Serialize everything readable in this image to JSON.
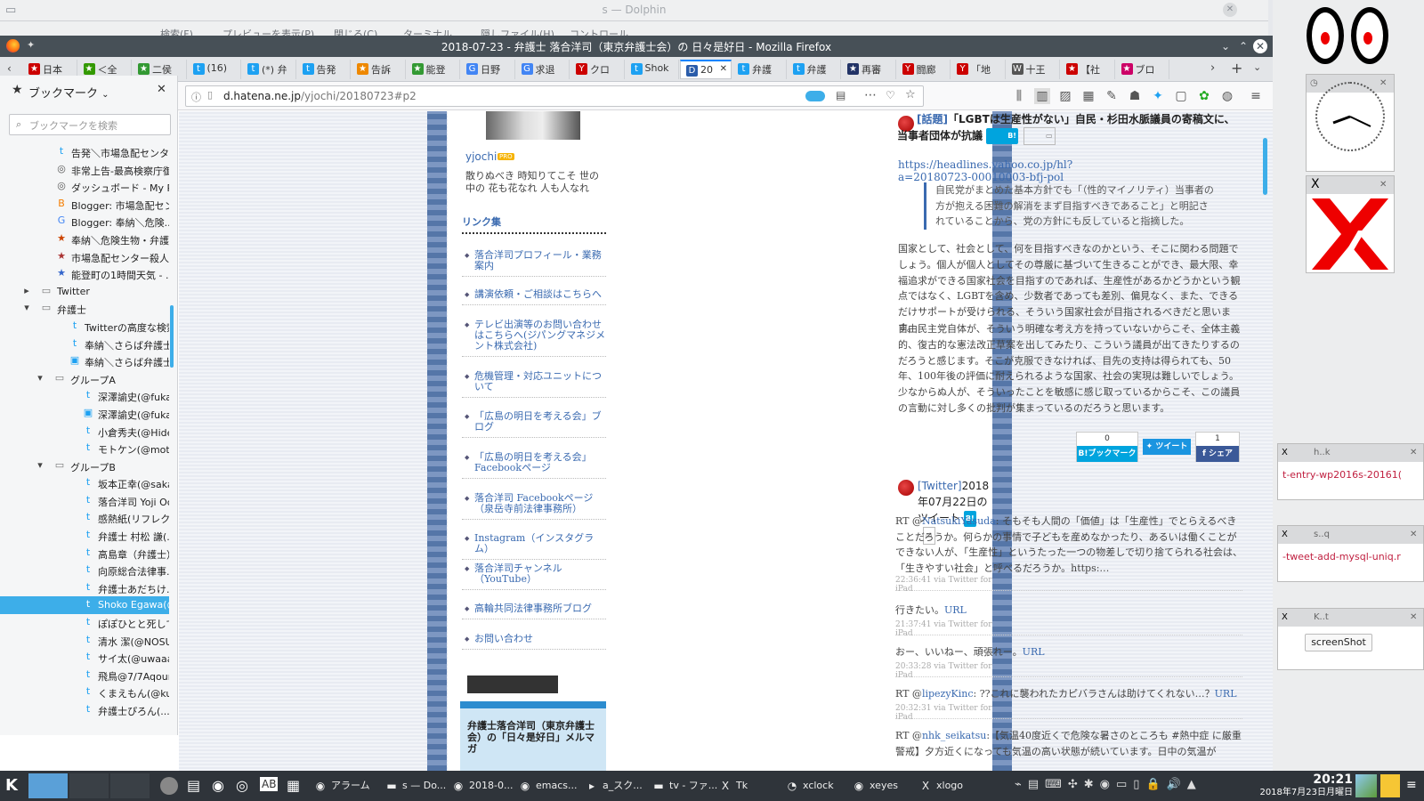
{
  "dolphin": {
    "title": "s — Dolphin",
    "toolbar": [
      "検索(F)",
      "プレビューを表示(P)",
      "閉じる(C)",
      "ターミナル",
      "隠しファイル(H)",
      "コントロール"
    ]
  },
  "firefox": {
    "title": "2018-07-23 - 弁護士 落合洋司（東京弁護士会）の 日々是好日 - Mozilla Firefox",
    "tabs": [
      {
        "label": "日本",
        "fav": "★",
        "color": "#c00"
      },
      {
        "label": "＜全",
        "fav": "★",
        "color": "#390"
      },
      {
        "label": "二侯",
        "fav": "★",
        "color": "#393"
      },
      {
        "label": "(16)",
        "fav": "t",
        "color": "#1da1f2"
      },
      {
        "label": "(*) 弁",
        "fav": "t",
        "color": "#1da1f2"
      },
      {
        "label": "告発",
        "fav": "t",
        "color": "#1da1f2"
      },
      {
        "label": "告訴",
        "fav": "★",
        "color": "#e80"
      },
      {
        "label": "能登",
        "fav": "★",
        "color": "#393"
      },
      {
        "label": "日野",
        "fav": "G",
        "color": "#4285f4"
      },
      {
        "label": "求退",
        "fav": "G",
        "color": "#4285f4"
      },
      {
        "label": "クロ",
        "fav": "Y",
        "color": "#c00"
      },
      {
        "label": "Shok",
        "fav": "t",
        "color": "#1da1f2"
      },
      {
        "label": "20",
        "fav": "D",
        "color": "#2a5caa",
        "active": true
      },
      {
        "label": "弁護",
        "fav": "t",
        "color": "#1da1f2"
      },
      {
        "label": "弁護",
        "fav": "t",
        "color": "#1da1f2"
      },
      {
        "label": "再審",
        "fav": "★",
        "color": "#236"
      },
      {
        "label": "闘廊",
        "fav": "Y",
        "color": "#c00"
      },
      {
        "label": "「地",
        "fav": "Y",
        "color": "#c00"
      },
      {
        "label": "十王",
        "fav": "W",
        "color": "#555"
      },
      {
        "label": "【社",
        "fav": "★",
        "color": "#c00"
      },
      {
        "label": "ブロ",
        "fav": "★",
        "color": "#c06"
      }
    ],
    "url_prefix": "d.hatena.ne.jp",
    "url_rest": "/yjochi/20180723#p2"
  },
  "sidebar": {
    "title": "ブックマーク",
    "search_placeholder": "ブックマークを検索",
    "items": [
      {
        "label": "告発＼市場急配センタ...",
        "indent": 1,
        "icon": "t",
        "color": "#1da1f2"
      },
      {
        "label": "非常上告-最高検察庁御...",
        "indent": 1,
        "icon": "◎",
        "color": "#555"
      },
      {
        "label": "ダッシュボード - My Pro...",
        "indent": 1,
        "icon": "◎",
        "color": "#555"
      },
      {
        "label": "Blogger: 市場急配セン...",
        "indent": 1,
        "icon": "B",
        "color": "#f57d00"
      },
      {
        "label": "Blogger: 奉納＼危険...",
        "indent": 1,
        "icon": "G",
        "color": "#4285f4"
      },
      {
        "label": "奉納＼危険生物・弁護...",
        "indent": 1,
        "icon": "★",
        "color": "#c40"
      },
      {
        "label": "市場急配センター殺人...",
        "indent": 1,
        "icon": "★",
        "color": "#a33"
      },
      {
        "label": "能登町の1時間天気 - ...",
        "indent": 1,
        "icon": "★",
        "color": "#36c"
      },
      {
        "label": "Twitter",
        "indent": 0,
        "icon": "▭",
        "color": "#777",
        "folder": "▸"
      },
      {
        "label": "弁護士",
        "indent": 0,
        "icon": "▭",
        "color": "#777",
        "folder": "▾"
      },
      {
        "label": "Twitterの高度な検索",
        "indent": 2,
        "icon": "t",
        "color": "#1da1f2"
      },
      {
        "label": "奉納＼さらば弁護士...",
        "indent": 2,
        "icon": "t",
        "color": "#1da1f2"
      },
      {
        "label": "奉納＼さらば弁護士...",
        "indent": 2,
        "icon": "▣",
        "color": "#1da1f2"
      },
      {
        "label": "グループA",
        "indent": 1,
        "icon": "▭",
        "color": "#777",
        "folder": "▾"
      },
      {
        "label": "深澤諭史(@fuka...",
        "indent": 3,
        "icon": "t",
        "color": "#1da1f2"
      },
      {
        "label": "深澤諭史(@fuka...",
        "indent": 3,
        "icon": "▣",
        "color": "#1da1f2"
      },
      {
        "label": "小倉秀夫(@Hide...",
        "indent": 3,
        "icon": "t",
        "color": "#1da1f2"
      },
      {
        "label": "モトケン(@moto...",
        "indent": 3,
        "icon": "t",
        "color": "#1da1f2"
      },
      {
        "label": "グループB",
        "indent": 1,
        "icon": "▭",
        "color": "#777",
        "folder": "▾"
      },
      {
        "label": "坂本正幸(@saka...",
        "indent": 3,
        "icon": "t",
        "color": "#1da1f2"
      },
      {
        "label": "落合洋司 Yoji Oc...",
        "indent": 3,
        "icon": "t",
        "color": "#1da1f2"
      },
      {
        "label": "感熱紙(リフレクタ...",
        "indent": 3,
        "icon": "t",
        "color": "#1da1f2"
      },
      {
        "label": "弁護士 村松 謙(...",
        "indent": 3,
        "icon": "t",
        "color": "#1da1f2"
      },
      {
        "label": "高島章（弁護士）(...",
        "indent": 3,
        "icon": "t",
        "color": "#1da1f2"
      },
      {
        "label": "向原総合法律事...",
        "indent": 3,
        "icon": "t",
        "color": "#1da1f2"
      },
      {
        "label": "弁護士あだちけ...",
        "indent": 3,
        "icon": "t",
        "color": "#1da1f2"
      },
      {
        "label": "Shoko Egawa(@...",
        "indent": 3,
        "icon": "t",
        "color": "#1da1f2",
        "selected": true
      },
      {
        "label": "ぽぽひとと死して...",
        "indent": 3,
        "icon": "t",
        "color": "#1da1f2"
      },
      {
        "label": "清水 潔(@NOSU...",
        "indent": 3,
        "icon": "t",
        "color": "#1da1f2"
      },
      {
        "label": "サイ太(@uwaaaa...",
        "indent": 3,
        "icon": "t",
        "color": "#1da1f2"
      },
      {
        "label": "飛鳥@7/7Aqour...",
        "indent": 3,
        "icon": "t",
        "color": "#1da1f2"
      },
      {
        "label": "くまえもん(@kum...",
        "indent": 3,
        "icon": "t",
        "color": "#1da1f2"
      },
      {
        "label": "弁護士ぴろん(...",
        "indent": 3,
        "icon": "t",
        "color": "#1da1f2"
      }
    ]
  },
  "blog": {
    "author": "yjochi",
    "author_tag": "PRO",
    "motto": "散りぬべき 時知りてこそ 世の中の 花も花なれ 人も人なれ",
    "links_title": "リンク集",
    "links": [
      "落合洋司プロフィール・業務案内",
      "講演依頼・ご相談はこちらへ",
      "テレビ出演等のお問い合わせはこちらへ(ジパングマネジメント株式会社)",
      "危機管理・対応ユニットについて",
      "「広島の明日を考える会」ブログ",
      "「広島の明日を考える会」Facebookページ",
      "落合洋司 Facebookページ（泉岳寺前法律事務所）",
      "Instagram（インスタグラム）",
      "落合洋司チャンネル（YouTube）",
      "高輪共同法律事務所ブログ",
      "お問い合わせ"
    ],
    "magazine": "弁護士落合洋司（東京弁護士会）の「日々是好日」メルマガ",
    "post1": {
      "category": "[話題]",
      "title": "「LGBTは生産性がない」自民・杉田水脈議員の寄稿文に、当事者団体が抗議",
      "url": "https://headlines.yahoo.co.jp/hl?a=20180723-00010003-bfj-pol",
      "quote": "自民党がまとめた基本方針でも「（性的マイノリティ）当事者の方が抱える困難の解消をまず目指すべきであること」と明記されていることから、党の方針にも反していると指摘した。",
      "para1": "国家として、社会として、何を目指すべきなのかという、そこに関わる問題でしょう。個人が個人としてその尊厳に基づいて生きることができ、最大限、幸福追求ができる国家社会を目指すのであれば、生産性があるかどうかという観点ではなく、LGBTを含め、少数者であっても差別、偏見なく、また、できるだけサポートが受けられる、そういう国家社会が目指されるべきだと思います。",
      "para2": "自由民主党自体が、そういう明確な考え方を持っていないからこそ、全体主義的、復古的な憲法改正草案を出してみたり、こういう議員が出てきたりするのだろうと感じます。そこが克服できなければ、目先の支持は得られても、50年、100年後の評価に耐えられるような国家、社会の実現は難しいでしょう。少なからぬ人が、そういったことを敏感に感じ取っているからこそ、この議員の言動に対し多くの批判が集まっているのだろうと思います。",
      "share": {
        "hatena_count": "0",
        "hatena_label": "B!ブックマーク",
        "tweet_label": "ツイート",
        "fb_count": "1",
        "fb_label": "シェア"
      }
    },
    "post2": {
      "category": "[Twitter]",
      "title": "2018年07月22日のツイート",
      "tweets": [
        {
          "pre": "RT @",
          "user": "NatsukiYasuda",
          "text": ": そもそも人間の「価値」は「生産性」でとらえるべきことだろうか。何らかの事情で子どもを産めなかったり、あるいは働くことができない人が、「生産性」というたった一つの物差しで切り捨てられる社会は、「生きやすい社会」と呼べるだろうか。https:…",
          "meta": "22:36:41 via Twitter for iPad"
        },
        {
          "pre": "",
          "user": "",
          "text": "行きたい。",
          "link": "URL",
          "meta": "21:37:41 via Twitter for iPad"
        },
        {
          "pre": "",
          "user": "",
          "text": "おー、いいねー、頑張れー。",
          "link": "URL",
          "meta": "20:33:28 via Twitter for iPad"
        },
        {
          "pre": "RT @",
          "user": "lipezyKinc",
          "text": ": ??これに襲われたカピバラさんは助けてくれない…？",
          "link": "URL",
          "meta": "20:32:31 via Twitter for iPad"
        },
        {
          "pre": "RT @",
          "user": "nhk_seikatsu",
          "text": ":【気温40度近くで危険な暑さのところも #熱中症 に厳重警戒】夕方近くになっても気温の高い状態が続いています。日中の気温が",
          "meta": ""
        }
      ]
    }
  },
  "widgets": {
    "clock_title": "",
    "x_title": "X",
    "win1_title": "h..k",
    "win1_text": "t-entry-wp2016s-20161(",
    "win2_title": "s..q",
    "win2_text": "-tweet-add-mysql-uniq.r",
    "win3_title": "K..t",
    "win3_button": "screenShot"
  },
  "taskbar": {
    "tasks": [
      {
        "label": "アラーム",
        "icon": "◉"
      },
      {
        "label": "s — Do...",
        "icon": "▬"
      },
      {
        "label": "2018-0...",
        "icon": "◉"
      },
      {
        "label": "emacs...",
        "icon": "◉"
      },
      {
        "label": "a_スク...",
        "icon": "▸"
      },
      {
        "label": "tv - ファ...",
        "icon": "▬"
      },
      {
        "label": "Tk",
        "icon": "X"
      },
      {
        "label": "xclock",
        "icon": "◔"
      },
      {
        "label": "xeyes",
        "icon": "◉"
      },
      {
        "label": "xlogo",
        "icon": "X"
      }
    ],
    "time": "20:21",
    "date": "2018年7月23日月曜日"
  }
}
